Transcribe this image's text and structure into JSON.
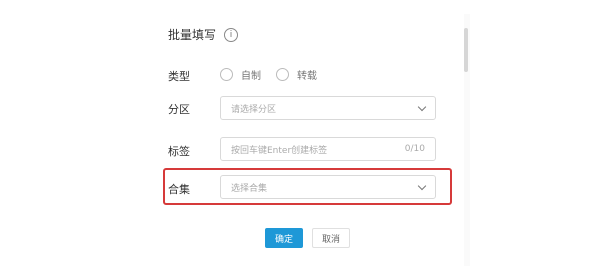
{
  "dialog": {
    "title": "批量填写",
    "info_icon": "i"
  },
  "form": {
    "type": {
      "label": "类型",
      "options": [
        "自制",
        "转载"
      ]
    },
    "partition": {
      "label": "分区",
      "placeholder": "请选择分区"
    },
    "tags": {
      "label": "标签",
      "placeholder": "按回车键Enter创建标签",
      "counter": "0/10"
    },
    "collection": {
      "label": "合集",
      "placeholder": "选择合集"
    }
  },
  "actions": {
    "confirm": "确定",
    "cancel": "取消"
  },
  "colors": {
    "primary": "#1e98d7",
    "highlight": "#d63a3a"
  }
}
